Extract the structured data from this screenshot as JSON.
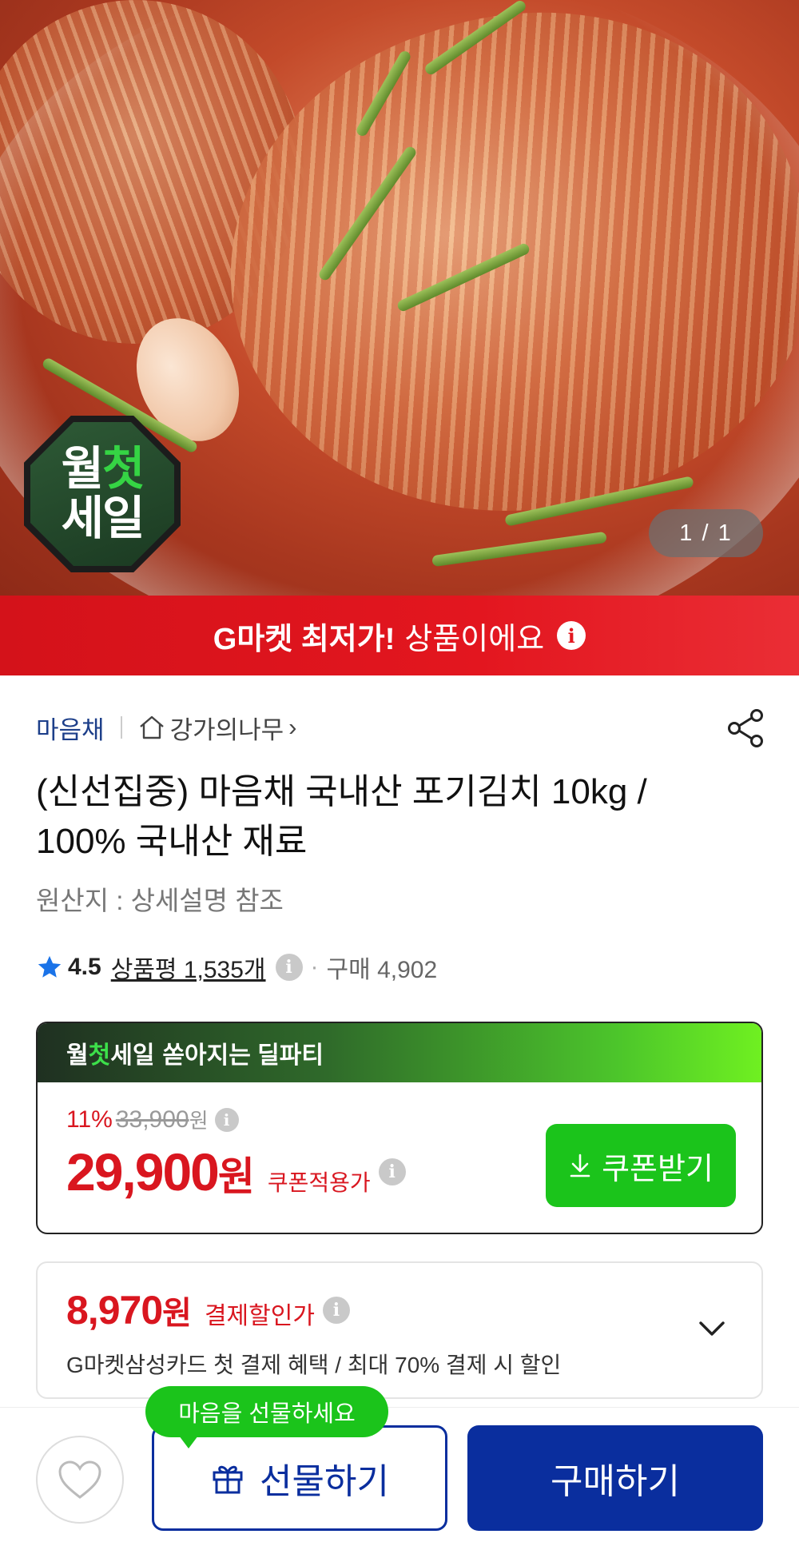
{
  "hero": {
    "image_description_icon": "kimchi-photo",
    "badge": {
      "line1_a": "월",
      "line1_b": "첫",
      "line2": "세일"
    },
    "counter": "1 / 1"
  },
  "lowest_banner": {
    "strong": "G마켓 최저가!",
    "rest": "상품이에요",
    "info": "i"
  },
  "seller": {
    "brand": "마음채",
    "store": "강가의나무",
    "store_arrow": "›"
  },
  "product": {
    "title": "(신선집중) 마음채 국내산 포기김치 10kg / 100% 국내산 재료",
    "origin": "원산지 : 상세설명 참조"
  },
  "rating": {
    "score": "4.5",
    "reviews": "상품평 1,535개",
    "info": "i",
    "dot": "·",
    "purchase": "구매 4,902"
  },
  "deal": {
    "head_a": "월",
    "head_b": "첫",
    "head_c": "세일",
    "head_rest": "쏟아지는 딜파티",
    "discount_pct": "11%",
    "original_price": "33,900",
    "original_unit": "원",
    "price": "29,900",
    "price_unit": "원",
    "price_label": "쿠폰적용가",
    "info": "i",
    "coupon_button": "쿠폰받기"
  },
  "payment": {
    "price": "8,970",
    "unit": "원",
    "label": "결제할인가",
    "info": "i",
    "description": "G마켓삼성카드 첫 결제 혜택 / 최대 70% 결제 시 할인"
  },
  "bottom": {
    "tooltip": "마음을 선물하세요",
    "gift_button": "선물하기",
    "buy_button": "구매하기"
  },
  "colors": {
    "brand_blue": "#0a2e9e",
    "sale_red": "#d9161f",
    "coupon_green": "#1bc41b"
  }
}
